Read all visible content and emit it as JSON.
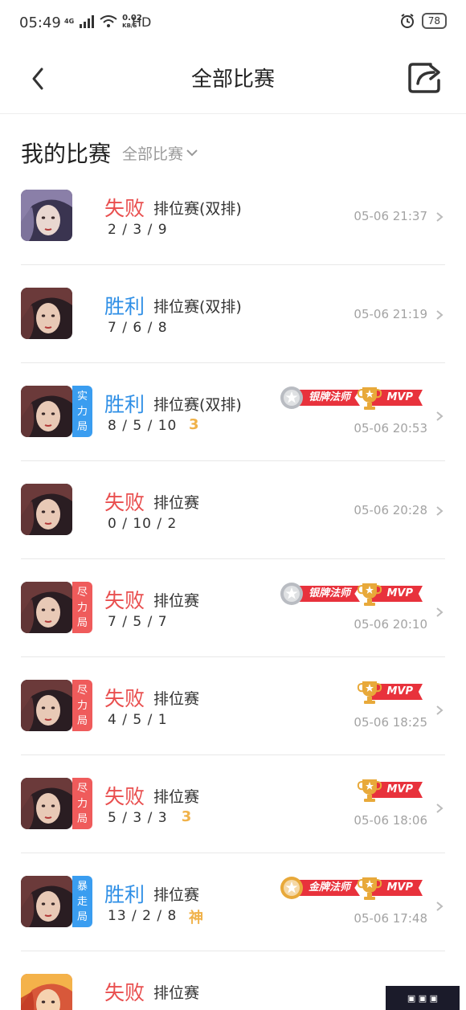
{
  "status_bar": {
    "time": "05:49",
    "network": "4G",
    "speed": "0.02",
    "speed_unit": "KB/S",
    "hd": "HD",
    "battery": "78"
  },
  "header": {
    "title": "全部比赛"
  },
  "section": {
    "title": "我的比赛",
    "filter": "全部比赛"
  },
  "matches": [
    {
      "result": "失败",
      "result_type": "lose",
      "mode": "排位赛(双排)",
      "kda": "2 / 3 / 9",
      "time": "05-06 21:37"
    },
    {
      "result": "胜利",
      "result_type": "win",
      "mode": "排位赛(双排)",
      "kda": "7 / 6 / 8",
      "time": "05-06 21:19"
    },
    {
      "result": "胜利",
      "result_type": "win",
      "tag": "实力局",
      "tag_lines": [
        "实",
        "力",
        "局"
      ],
      "tag_color": "blue",
      "mode": "排位赛(双排)",
      "kda": "8 / 5 / 10",
      "kda_badge": "3",
      "time": "05-06 20:53",
      "badges": [
        "银牌法师",
        "MVP"
      ]
    },
    {
      "result": "失败",
      "result_type": "lose",
      "mode": "排位赛",
      "kda": "0 / 10 / 2",
      "time": "05-06 20:28"
    },
    {
      "result": "失败",
      "result_type": "lose",
      "tag": "尽力局",
      "tag_lines": [
        "尽",
        "力",
        "局"
      ],
      "tag_color": "red",
      "mode": "排位赛",
      "kda": "7 / 5 / 7",
      "time": "05-06 20:10",
      "badges": [
        "银牌法师",
        "MVP"
      ]
    },
    {
      "result": "失败",
      "result_type": "lose",
      "tag": "尽力局",
      "tag_lines": [
        "尽",
        "力",
        "局"
      ],
      "tag_color": "red",
      "mode": "排位赛",
      "kda": "4 / 5 / 1",
      "time": "05-06 18:25",
      "badges": [
        "MVP"
      ]
    },
    {
      "result": "失败",
      "result_type": "lose",
      "tag": "尽力局",
      "tag_lines": [
        "尽",
        "力",
        "局"
      ],
      "tag_color": "red",
      "mode": "排位赛",
      "kda": "5 / 3 / 3",
      "kda_badge": "3",
      "time": "05-06 18:06",
      "badges": [
        "MVP"
      ]
    },
    {
      "result": "胜利",
      "result_type": "win",
      "tag": "暴走局",
      "tag_lines": [
        "暴",
        "走",
        "局"
      ],
      "tag_color": "blue",
      "mode": "排位赛",
      "kda": "13 / 2 / 8",
      "kda_badge": "神",
      "time": "05-06 17:48",
      "badges": [
        "金牌法师",
        "MVP"
      ]
    },
    {
      "result": "失败",
      "result_type": "lose",
      "mode": "排位赛",
      "kda": "",
      "time": ""
    }
  ],
  "colors": {
    "win": "#2f8fe6",
    "lose": "#e94f4f",
    "tag_blue": "#3a9df0",
    "tag_red": "#ef5b5b",
    "ribbon": "#e8323c"
  },
  "icons": [
    "back-arrow-icon",
    "share-icon",
    "chevron-down-icon",
    "chevron-right-icon",
    "trophy-icon",
    "medal-icon"
  ]
}
